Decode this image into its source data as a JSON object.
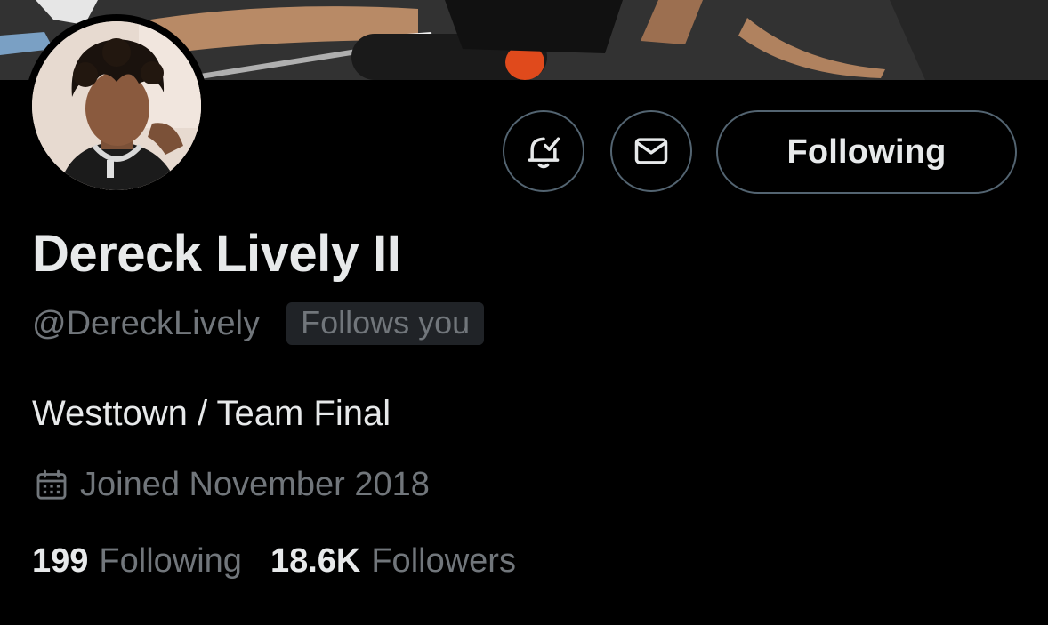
{
  "profile": {
    "display_name": "Dereck Lively II",
    "handle": "@DereckLively",
    "follows_you_badge": "Follows you",
    "bio": "Westtown / Team Final",
    "joined": "Joined November 2018"
  },
  "actions": {
    "following_label": "Following",
    "notify_icon": "bell-check-icon",
    "message_icon": "envelope-icon"
  },
  "stats": {
    "following_count": "199",
    "following_label": "Following",
    "followers_count": "18.6K",
    "followers_label": "Followers"
  },
  "colors": {
    "background": "#000000",
    "primary_text": "#e7e9ea",
    "secondary_text": "#71767b",
    "border": "#536471",
    "badge_bg": "#202327"
  }
}
